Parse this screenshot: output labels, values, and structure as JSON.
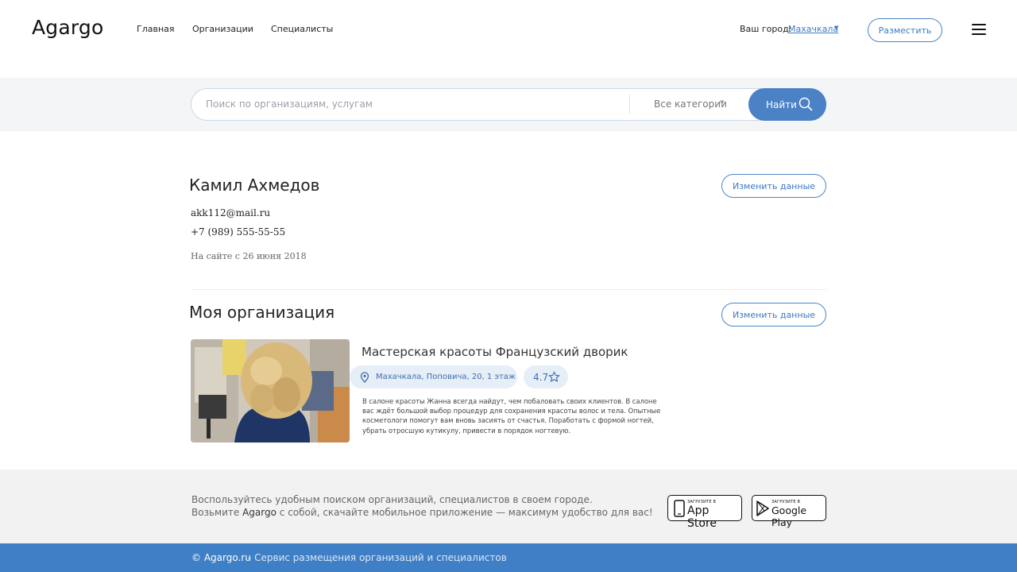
{
  "header": {
    "logo": "Agargo",
    "nav": [
      "Главная",
      "Организации",
      "Специалисты"
    ],
    "city_label": "Ваш город:",
    "city_value": "Махачкала",
    "place_button": "Разместить",
    "menu_icon": "hamburger-menu-icon"
  },
  "search": {
    "placeholder": "Поиск по организациям, услугам",
    "category": "Все категории",
    "button": "Найти",
    "icon": "search-icon"
  },
  "profile": {
    "name": "Камил Ахмедов",
    "edit_button": "Изменить данные",
    "email": "akk112@mail.ru",
    "phone": "+7 (989) 555-55-55",
    "since": "На сайте с 26 июня 2018"
  },
  "organization": {
    "section_title": "Моя организация",
    "edit_button": "Изменить данные",
    "name": "Мастерская красоты Французский дворик",
    "address": "Махачкала, Поповича, 20, 1 этаж",
    "rating": "4.7",
    "description": "В салоне красоты Жанна всегда найдут, чем побаловать своих клиентов. В салоне вас ждёт большой выбор процедур для сохранения красоты волос и тела. Опытные косметологи помогут вам вновь засиять от счастья. Поработать с формой ногтей, убрать отросшую кутикулу, привести в порядок ногтевую.",
    "photo_icon": "salon-photo"
  },
  "app_promo": {
    "line1": "Воспользуйтесь удобным поиском организаций, специалистов в своем городе.",
    "line2_before": "Возьмите",
    "line2_brand": "Agargo",
    "line2_after": "с собой, скачайте мобильное приложение — максимум удобство для вас!",
    "appstore_small": "ЗАГРУЗИТЕ В",
    "appstore_big": "App Store",
    "googleplay_small": "ЗАГРУЗИТЕ В",
    "googleplay_big": "Google Play"
  },
  "footer": {
    "copyright": "© Agargo.ru",
    "description": "- Сервис размещения организаций и специалистов"
  },
  "colors": {
    "accent": "#3f7fc6",
    "button_blue": "#4a82c5",
    "pill_bg": "#e6eef8",
    "band_gray": "#f2f2f2"
  }
}
